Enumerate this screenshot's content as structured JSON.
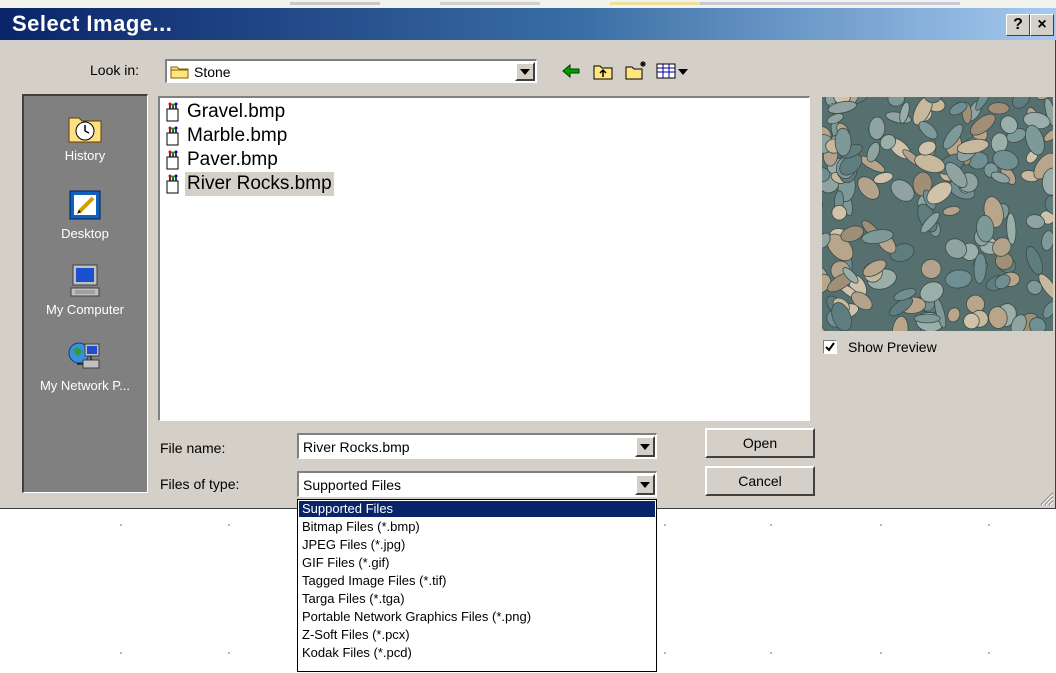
{
  "dialog": {
    "title": "Select Image...",
    "help_button": "?",
    "close_button": "×",
    "look_in_label": "Look in:",
    "look_in_value": "Stone",
    "file_name_label": "File name:",
    "file_name_value": "River Rocks.bmp",
    "files_of_type_label": "Files of type:",
    "files_of_type_value": "Supported Files",
    "open_label": "Open",
    "cancel_label": "Cancel",
    "show_preview_label": "Show Preview",
    "show_preview_checked": true
  },
  "toolbar": {
    "icons": [
      "back-arrow-icon",
      "up-folder-icon",
      "new-folder-icon",
      "view-menu-icon"
    ]
  },
  "places": [
    {
      "label": "History",
      "icon": "history-icon"
    },
    {
      "label": "Desktop",
      "icon": "desktop-icon"
    },
    {
      "label": "My Computer",
      "icon": "my-computer-icon"
    },
    {
      "label": "My Network P...",
      "icon": "network-places-icon"
    }
  ],
  "files": [
    {
      "name": "Gravel.bmp",
      "selected": false
    },
    {
      "name": "Marble.bmp",
      "selected": false
    },
    {
      "name": "Paver.bmp",
      "selected": false
    },
    {
      "name": "River Rocks.bmp",
      "selected": true
    }
  ],
  "file_types": [
    {
      "label": "Supported Files",
      "selected": true
    },
    {
      "label": "Bitmap Files (*.bmp)",
      "selected": false
    },
    {
      "label": "JPEG Files (*.jpg)",
      "selected": false
    },
    {
      "label": "GIF Files (*.gif)",
      "selected": false
    },
    {
      "label": "Tagged Image Files (*.tif)",
      "selected": false
    },
    {
      "label": "Targa Files (*.tga)",
      "selected": false
    },
    {
      "label": "Portable Network Graphics Files (*.png)",
      "selected": false
    },
    {
      "label": "Z-Soft Files (*.pcx)",
      "selected": false
    },
    {
      "label": "Kodak Files (*.pcd)",
      "selected": false
    }
  ],
  "colors": {
    "title_gradient_start": "#0a246a",
    "title_gradient_end": "#a6caf0",
    "dialog_face": "#d4d0c8",
    "selection": "#0a246a"
  }
}
